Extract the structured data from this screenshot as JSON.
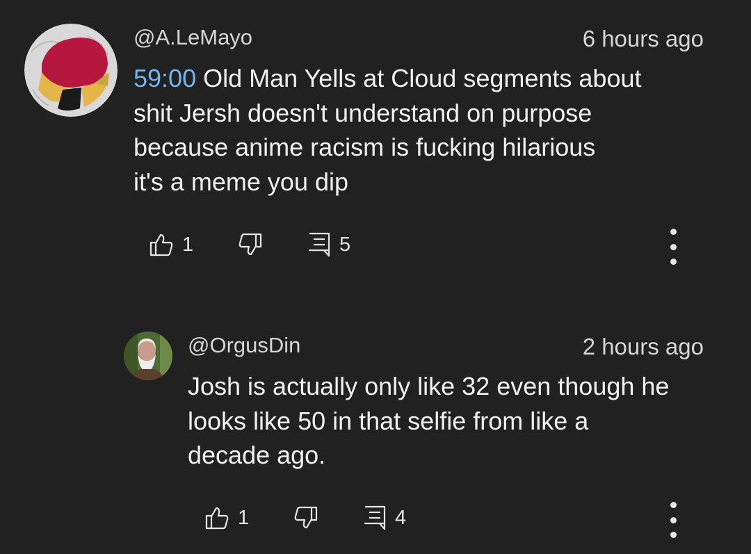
{
  "comments": [
    {
      "author": "@A.LeMayo",
      "time": "6 hours ago",
      "timestamp_link": "59:00",
      "lines": [
        " Old Man Yells at Cloud segments about",
        "shit Jersh doesn't understand on purpose",
        "because anime racism is fucking hilarious",
        "it's a meme you dip"
      ],
      "likes": "1",
      "replies": "5",
      "icons": {
        "avatar": "avatar",
        "like": "thumbs-up-icon",
        "dislike": "thumbs-down-icon",
        "reply": "reply-icon",
        "more": "more-vertical-icon"
      }
    },
    {
      "author": "@OrgusDin",
      "time": "2 hours ago",
      "lines": [
        "Josh is actually only like 32 even though he",
        "looks like 50 in that selfie from like a",
        "decade ago."
      ],
      "likes": "1",
      "replies": "4",
      "icons": {
        "avatar": "avatar",
        "like": "thumbs-up-icon",
        "dislike": "thumbs-down-icon",
        "reply": "reply-icon",
        "more": "more-vertical-icon"
      }
    }
  ],
  "colors": {
    "background": "#212121",
    "text": "#f1f1f1",
    "secondary_text": "#d6d6d6",
    "timestamp_link": "#73b5f0"
  }
}
